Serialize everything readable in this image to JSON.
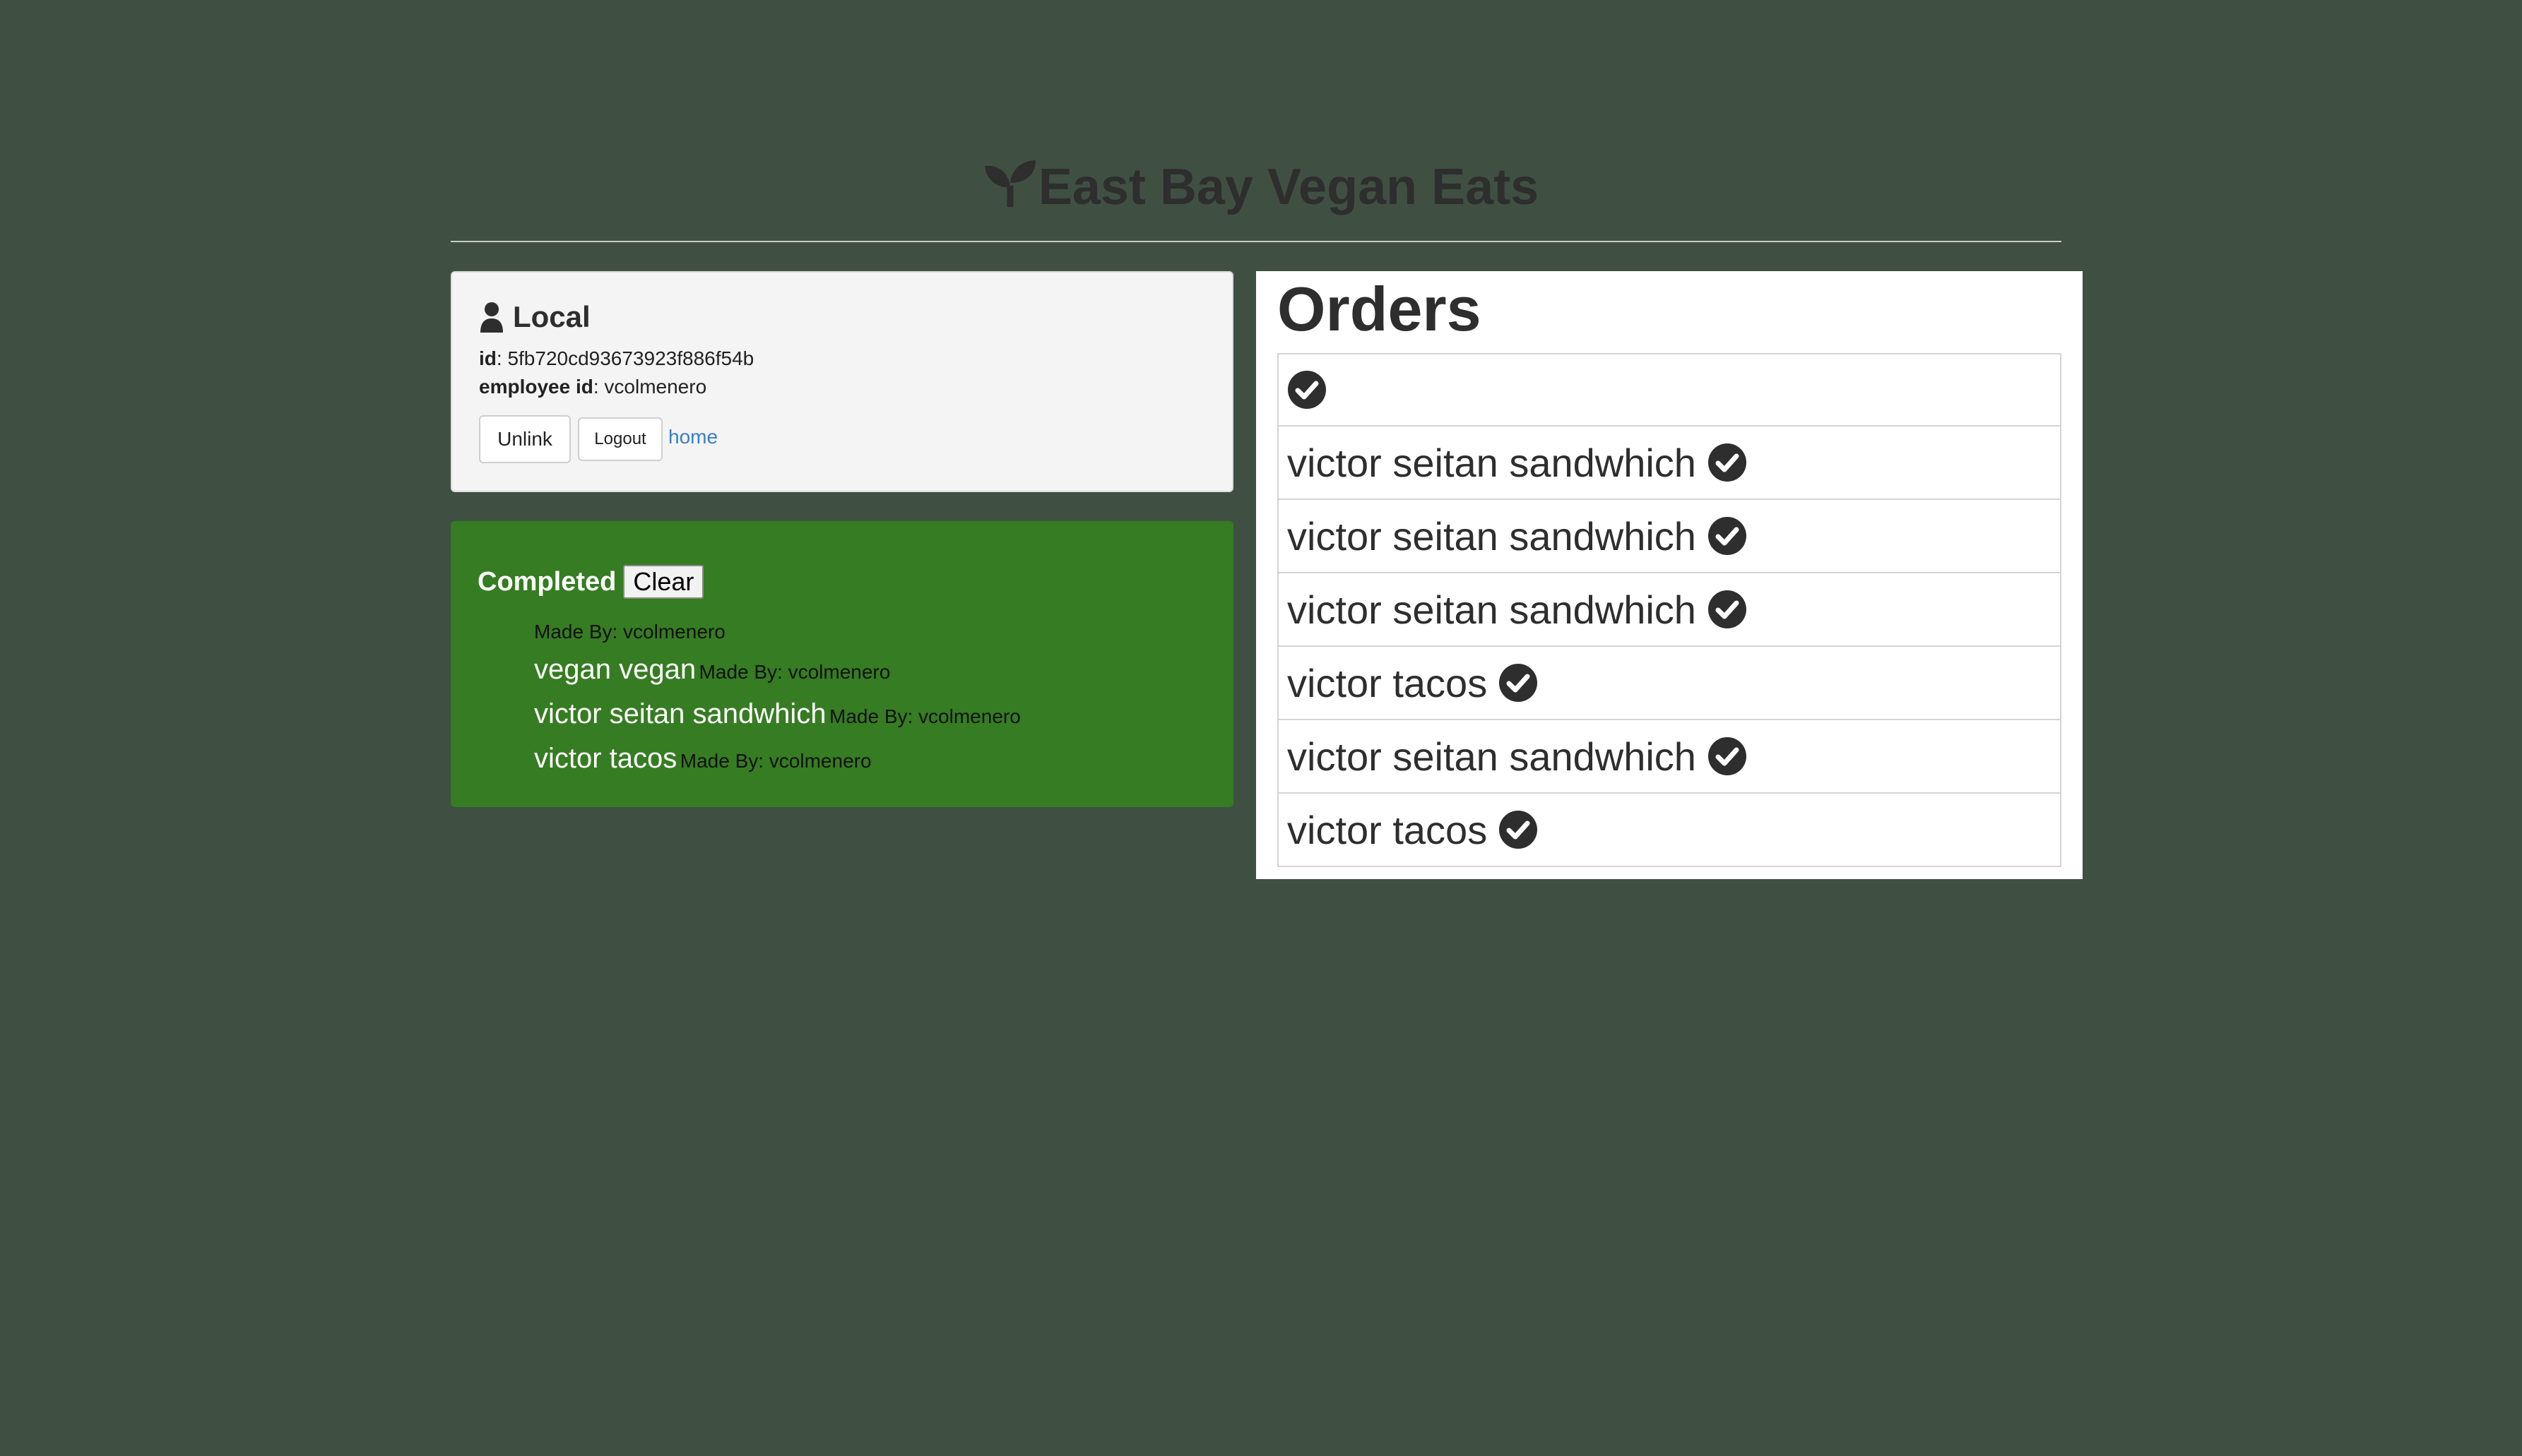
{
  "header": {
    "title": "East Bay Vegan Eats",
    "icon": "seedling-icon"
  },
  "profile": {
    "title": "Local",
    "id_label": "id",
    "id_value": "5fb720cd93673923f886f54b",
    "employee_label": "employee id",
    "employee_value": "vcolmenero",
    "unlink_label": "Unlink",
    "logout_label": "Logout",
    "home_label": "home"
  },
  "completed": {
    "label": "Completed",
    "clear_label": "Clear",
    "items": [
      {
        "name": "",
        "made_by": "Made By: vcolmenero"
      },
      {
        "name": "vegan vegan",
        "made_by": "Made By: vcolmenero"
      },
      {
        "name": "victor seitan sandwhich",
        "made_by": "Made By: vcolmenero"
      },
      {
        "name": "victor tacos",
        "made_by": "Made By: vcolmenero"
      }
    ]
  },
  "orders": {
    "title": "Orders",
    "items": [
      {
        "name": ""
      },
      {
        "name": "victor seitan sandwhich"
      },
      {
        "name": "victor seitan sandwhich"
      },
      {
        "name": "victor seitan sandwhich"
      },
      {
        "name": "victor tacos"
      },
      {
        "name": "victor seitan sandwhich"
      },
      {
        "name": "victor tacos"
      }
    ]
  },
  "colors": {
    "background": "#3f5042",
    "completed_bg": "#367c22",
    "link": "#3a7ec6"
  }
}
